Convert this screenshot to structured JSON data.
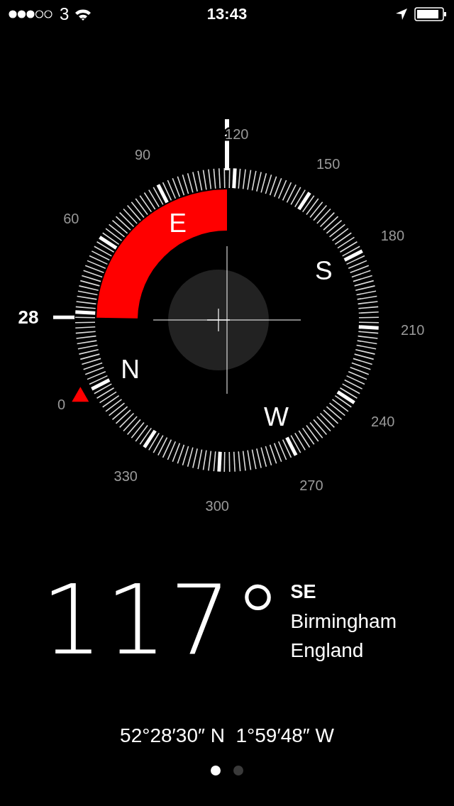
{
  "status_bar": {
    "carrier": "3",
    "time": "13:43"
  },
  "compass": {
    "marker_bearing": "28",
    "dial_labels": [
      "0",
      "60",
      "90",
      "120",
      "150",
      "180",
      "210",
      "240",
      "270",
      "300",
      "330"
    ],
    "cardinals": [
      "N",
      "E",
      "S",
      "W"
    ]
  },
  "reading": {
    "heading": "117°",
    "direction": "SE",
    "city": "Birmingham",
    "region": "England"
  },
  "coordinates": "52°28′30″ N  1°59′48″ W",
  "page_dots": [
    {
      "selected": true
    },
    {
      "selected": false
    }
  ]
}
